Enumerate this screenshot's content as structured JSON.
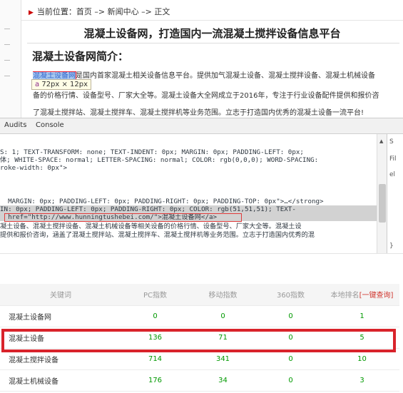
{
  "page": {
    "breadcrumb": "当前位置：首页 –> 新闻中心 –> 正文",
    "headline": "混凝土设备网，打造国内一流混凝土搅拌设备信息平台",
    "section_title": "混凝土设备网简介：",
    "highlighted_link": "混凝土设备网",
    "para1_rest": "是国内首家混凝土相关设备信息平台。提供加气混凝土设备、混凝土搅拌设备、混凝土机械设备",
    "para2": "备的价格行情、设备型号、厂家大全等。混凝土设备大全网成立于2016年，专注于行业设备配件提供和报价咨",
    "para3": "了混凝土搅拌站、混凝土搅拌车、混凝土搅拌机等业务范围。立志于打造国内优秀的混凝土设备一流平台!",
    "dimension_tip": {
      "tag": "a",
      "size": "72px × 12px"
    }
  },
  "devtools": {
    "tabs": [
      "Audits",
      "Console"
    ],
    "code_lines": [
      "S: 1; TEXT-TRANSFORM: none; TEXT-INDENT: 0px; MARGIN: 0px; PADDING-LEFT: 0px;",
      "体; WHITE-SPACE: normal; LETTER-SPACING: normal; COLOR: rgb(0,0,0); WORD-SPACING:",
      "roke-width: 0px\">",
      "  MARGIN: 0px; PADDING-LEFT: 0px; PADDING-RIGHT: 0px; PADDING-TOP: 0px\">…</strong>",
      "IN: 0px; PADDING-LEFT: 0px; PADDING-RIGHT: 0px; COLOR: rgb(51,51,51); TEXT-",
      "  href=\"http://www.hunningtushebei.com/\">混凝土设备网</a>",
      "凝土设备、混凝土搅拌设备、混凝土机械设备等相关设备的价格行情、设备型号、厂家大全等。混凝土设",
      "提供和报价咨询，涵盖了混凝土搅拌站、混凝土搅拌车、混凝土搅拌机等业务范围。立志于打造国内优秀的混"
    ],
    "side": [
      "S",
      "Fil",
      "el",
      "}",
      "="
    ]
  },
  "table": {
    "headers": [
      "关键词",
      "PC指数",
      "移动指数",
      "360指数",
      "本地排名"
    ],
    "one_click_query": "[一键查询]",
    "rows": [
      [
        "混凝土设备网",
        "0",
        "0",
        "0",
        "1"
      ],
      [
        "混凝土设备",
        "136",
        "71",
        "0",
        "5"
      ],
      [
        "混凝土搅拌设备",
        "714",
        "341",
        "0",
        "10"
      ],
      [
        "混凝土机械设备",
        "176",
        "34",
        "0",
        "3"
      ]
    ]
  },
  "colors": {
    "highlight_box": "#d9232b",
    "green_value": "#009900",
    "link_blue": "#3366cc"
  }
}
